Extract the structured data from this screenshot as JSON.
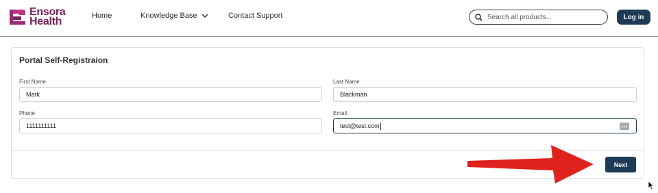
{
  "brand": {
    "line1": "Ensora",
    "line2": "Health",
    "color": "#7b1f5e"
  },
  "nav": {
    "home": "Home",
    "knowledge_base": "Knowledge Base",
    "contact_support": "Contact Support"
  },
  "search": {
    "placeholder": "Search all products...",
    "value": ""
  },
  "login_label": "Log in",
  "form": {
    "title": "Portal Self-Registraion",
    "first_name": {
      "label": "First Name",
      "value": "Mark"
    },
    "last_name": {
      "label": "Last Name",
      "value": "Blackman"
    },
    "phone": {
      "label": "Phone",
      "value": "1111111111"
    },
    "email": {
      "label": "Email",
      "value": "test@test.com"
    },
    "next_label": "Next"
  },
  "colors": {
    "primary": "#1d3b56",
    "annotation_arrow": "#e0221f"
  }
}
